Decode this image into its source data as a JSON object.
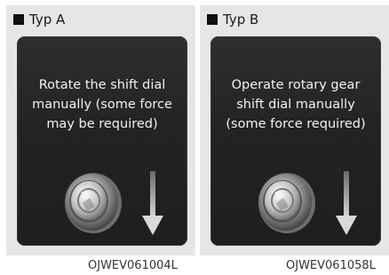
{
  "panels": [
    {
      "title": "Typ A",
      "message": "Rotate the shift dial\nmanually (some force\nmay be required)",
      "code": "OJWEV061004L"
    },
    {
      "title": "Typ B",
      "message": "Operate rotary gear\nshift dial manually\n(some force required)",
      "code": "OJWEV061058L"
    }
  ],
  "icons": [
    "rotary-dial-icon",
    "down-arrow-icon"
  ]
}
